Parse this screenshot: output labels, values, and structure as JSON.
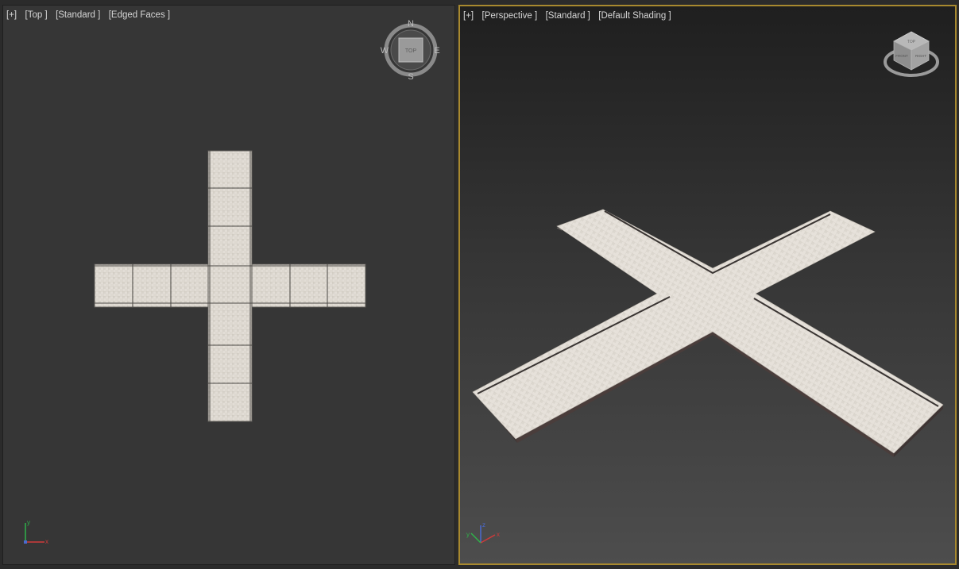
{
  "left_viewport": {
    "labels": {
      "plus": "[+]",
      "view": "[Top ]",
      "mode": "[Standard ]",
      "shading": "[Edged Faces ]"
    },
    "compass": {
      "north": "N",
      "south": "S",
      "east": "E",
      "west": "W",
      "center": "TOP"
    },
    "axis": {
      "y": "y",
      "x": "x"
    }
  },
  "right_viewport": {
    "active": true,
    "labels": {
      "plus": "[+]",
      "view": "[Perspective ]",
      "mode": "[Standard ]",
      "shading": "[Default Shading ]"
    },
    "viewcube": {
      "face_top": "TOP",
      "face_front": "FRONT",
      "face_right": "RIGHT"
    },
    "axis": {
      "z": "z",
      "y": "y",
      "x": "x"
    }
  },
  "colors": {
    "active_border": "#a8892f",
    "tile": "#e2ddd6",
    "grid_line": "#8a8680"
  }
}
